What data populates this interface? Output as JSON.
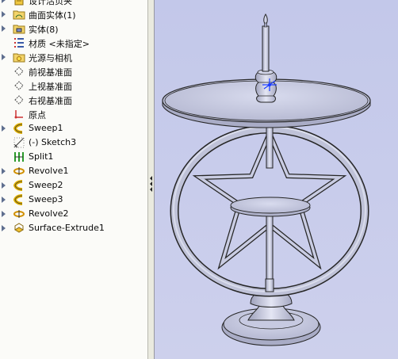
{
  "feature_tree": {
    "items": [
      {
        "label": "设计活页夹",
        "icon": "design-binder-icon",
        "expandable": true
      },
      {
        "label": "曲面实体(1)",
        "icon": "surface-bodies-folder-icon",
        "expandable": true
      },
      {
        "label": "实体(8)",
        "icon": "solid-bodies-folder-icon",
        "expandable": true
      },
      {
        "label": "材质 <未指定>",
        "icon": "material-icon",
        "expandable": false
      },
      {
        "label": "光源与相机",
        "icon": "lights-cameras-folder-icon",
        "expandable": true
      },
      {
        "label": "前视基准面",
        "icon": "plane-icon",
        "expandable": false
      },
      {
        "label": "上视基准面",
        "icon": "plane-icon",
        "expandable": false
      },
      {
        "label": "右视基准面",
        "icon": "plane-icon",
        "expandable": false
      },
      {
        "label": "原点",
        "icon": "origin-icon",
        "expandable": false
      },
      {
        "label": "Sweep1",
        "icon": "sweep-icon",
        "expandable": true
      },
      {
        "label": "(-) Sketch3",
        "icon": "sketch-icon",
        "expandable": false
      },
      {
        "label": "Split1",
        "icon": "split-icon",
        "expandable": false
      },
      {
        "label": "Revolve1",
        "icon": "revolve-icon",
        "expandable": true
      },
      {
        "label": "Sweep2",
        "icon": "sweep-icon",
        "expandable": true
      },
      {
        "label": "Sweep3",
        "icon": "sweep-icon",
        "expandable": true
      },
      {
        "label": "Revolve2",
        "icon": "revolve-icon",
        "expandable": true
      },
      {
        "label": "Surface-Extrude1",
        "icon": "surface-extrude-icon",
        "expandable": true
      }
    ]
  },
  "graphics": {
    "model_color": "#bfc2d8",
    "edge_color": "#262626",
    "background_color": "#c8cce8",
    "triad_color": "#1a3cff"
  }
}
